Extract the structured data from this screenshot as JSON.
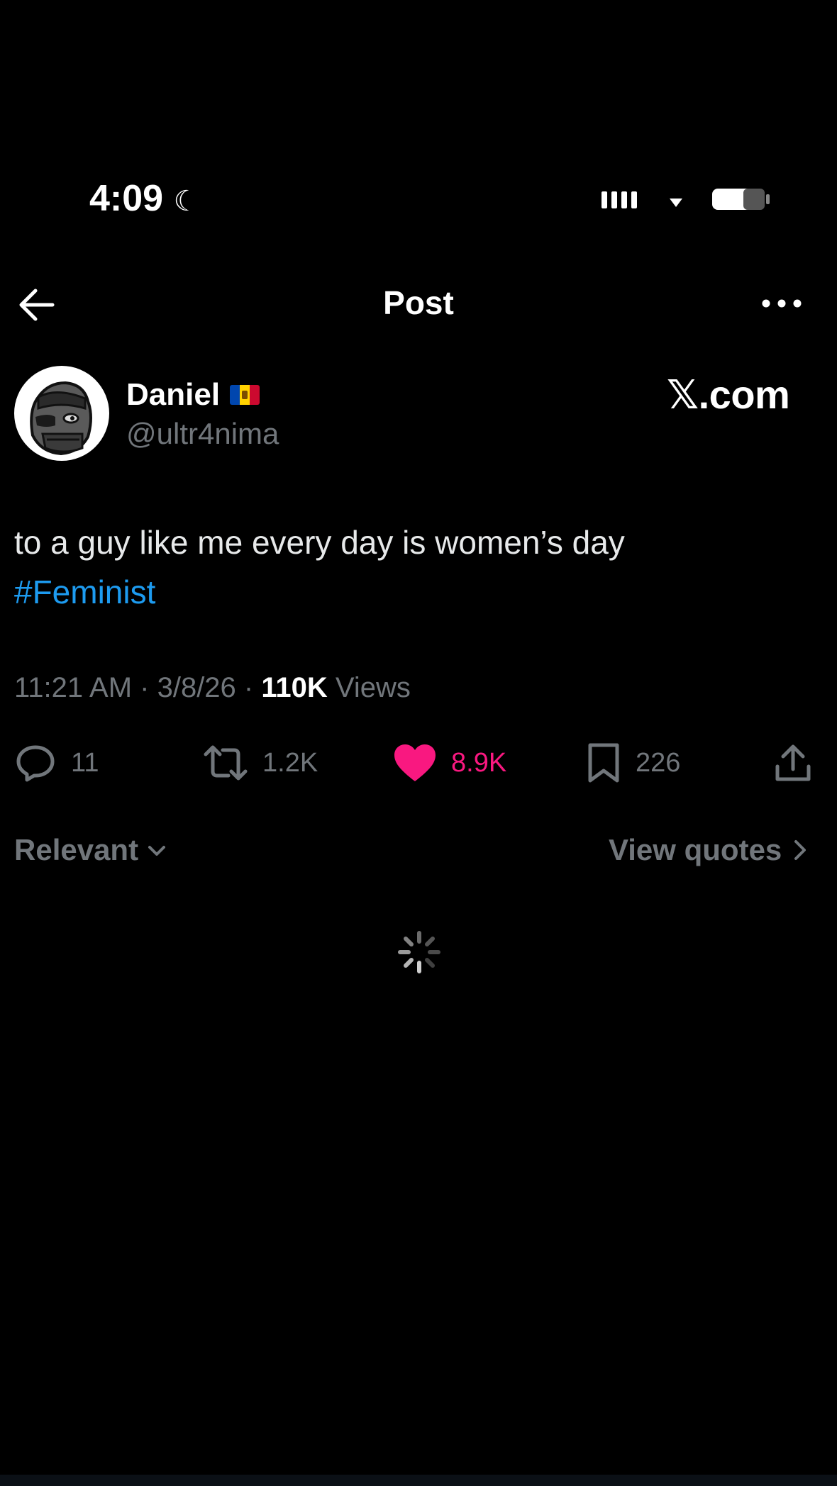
{
  "status_bar": {
    "time": "4:09"
  },
  "header": {
    "title": "Post"
  },
  "post": {
    "author_name": "Daniel",
    "author_handle": "@ultr4nima",
    "watermark": "𝕏.com",
    "text": "to a guy like me every day is women’s day",
    "hashtag": "#Feminist",
    "timestamp": "11:21 AM · 3/8/26 · ",
    "views_count": "110K",
    "views_label": " Views",
    "replies": "11",
    "reposts": "1.2K",
    "likes": "8.9K",
    "bookmarks": "226"
  },
  "replies_bar": {
    "sort_label": "Relevant",
    "quotes_label": "View quotes"
  },
  "colors": {
    "background": "#000000",
    "text": "#e7e9ea",
    "muted": "#71767b",
    "link": "#1d9bf0",
    "like": "#f91880"
  },
  "icons": [
    "back-arrow-icon",
    "more-icon",
    "reply-icon",
    "repost-icon",
    "heart-icon",
    "bookmark-icon",
    "share-icon",
    "chevron-down-icon",
    "chevron-right-icon",
    "loading-spinner-icon",
    "moon-icon",
    "signal-icon",
    "wifi-icon",
    "battery-icon"
  ]
}
